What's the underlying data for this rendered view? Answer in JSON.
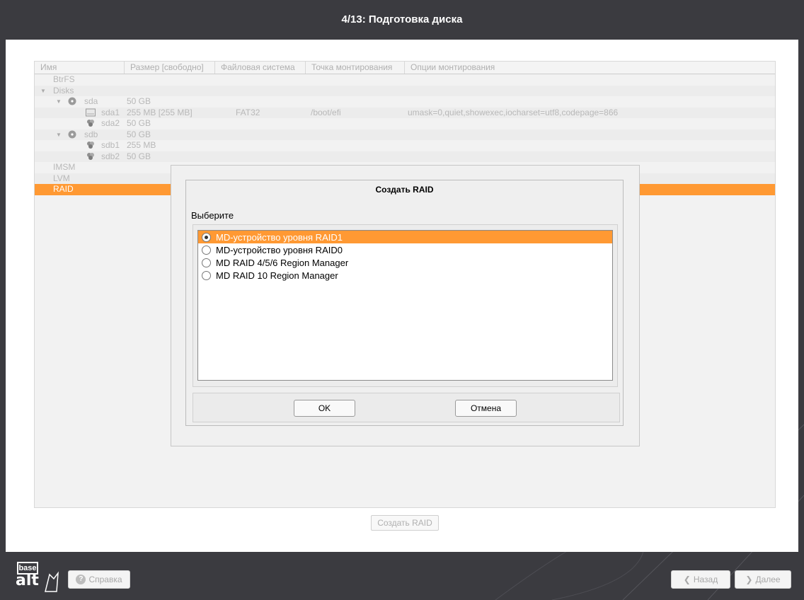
{
  "window": {
    "title": "4/13: Подготовка диска"
  },
  "table": {
    "columns": [
      "Имя",
      "Размер [свободно]",
      "Файловая система",
      "Точка монтирования",
      "Опции монтирования"
    ],
    "rows": [
      {
        "name": "BtrFS",
        "size": "",
        "fs": "",
        "mount": "",
        "options": ""
      },
      {
        "name": "Disks",
        "size": "",
        "fs": "",
        "mount": "",
        "options": ""
      },
      {
        "name": "sda",
        "size": "50 GB",
        "fs": "",
        "mount": "",
        "options": ""
      },
      {
        "name": "sda1",
        "size": "255 MB [255 MB]",
        "fs": "FAT32",
        "mount": "/boot/efi",
        "options": "umask=0,quiet,showexec,iocharset=utf8,codepage=866"
      },
      {
        "name": "sda2",
        "size": "50 GB",
        "fs": "",
        "mount": "",
        "options": ""
      },
      {
        "name": "sdb",
        "size": "50 GB",
        "fs": "",
        "mount": "",
        "options": ""
      },
      {
        "name": "sdb1",
        "size": "255 MB",
        "fs": "",
        "mount": "",
        "options": ""
      },
      {
        "name": "sdb2",
        "size": "50 GB",
        "fs": "",
        "mount": "",
        "options": ""
      },
      {
        "name": "IMSM",
        "size": "",
        "fs": "",
        "mount": "",
        "options": ""
      },
      {
        "name": "LVM",
        "size": "",
        "fs": "",
        "mount": "",
        "options": ""
      },
      {
        "name": "RAID",
        "size": "",
        "fs": "",
        "mount": "",
        "options": ""
      }
    ],
    "selected": "RAID"
  },
  "create_raid_button": "Создать RAID",
  "dialog": {
    "title": "Создать RAID",
    "prompt": "Выберите",
    "options": [
      "MD-устройство уровня RAID1",
      "MD-устройство уровня RAID0",
      "MD RAID 4/5/6 Region Manager",
      "MD RAID 10 Region Manager"
    ],
    "selected_index": 0,
    "ok": "OK",
    "cancel": "Отмена"
  },
  "footer": {
    "logo_top": "base",
    "logo_bottom": "alt",
    "help": "Справка",
    "back": "Назад",
    "next": "Далее"
  },
  "colors": {
    "accent": "#ff9933",
    "background": "#3b3b40"
  }
}
